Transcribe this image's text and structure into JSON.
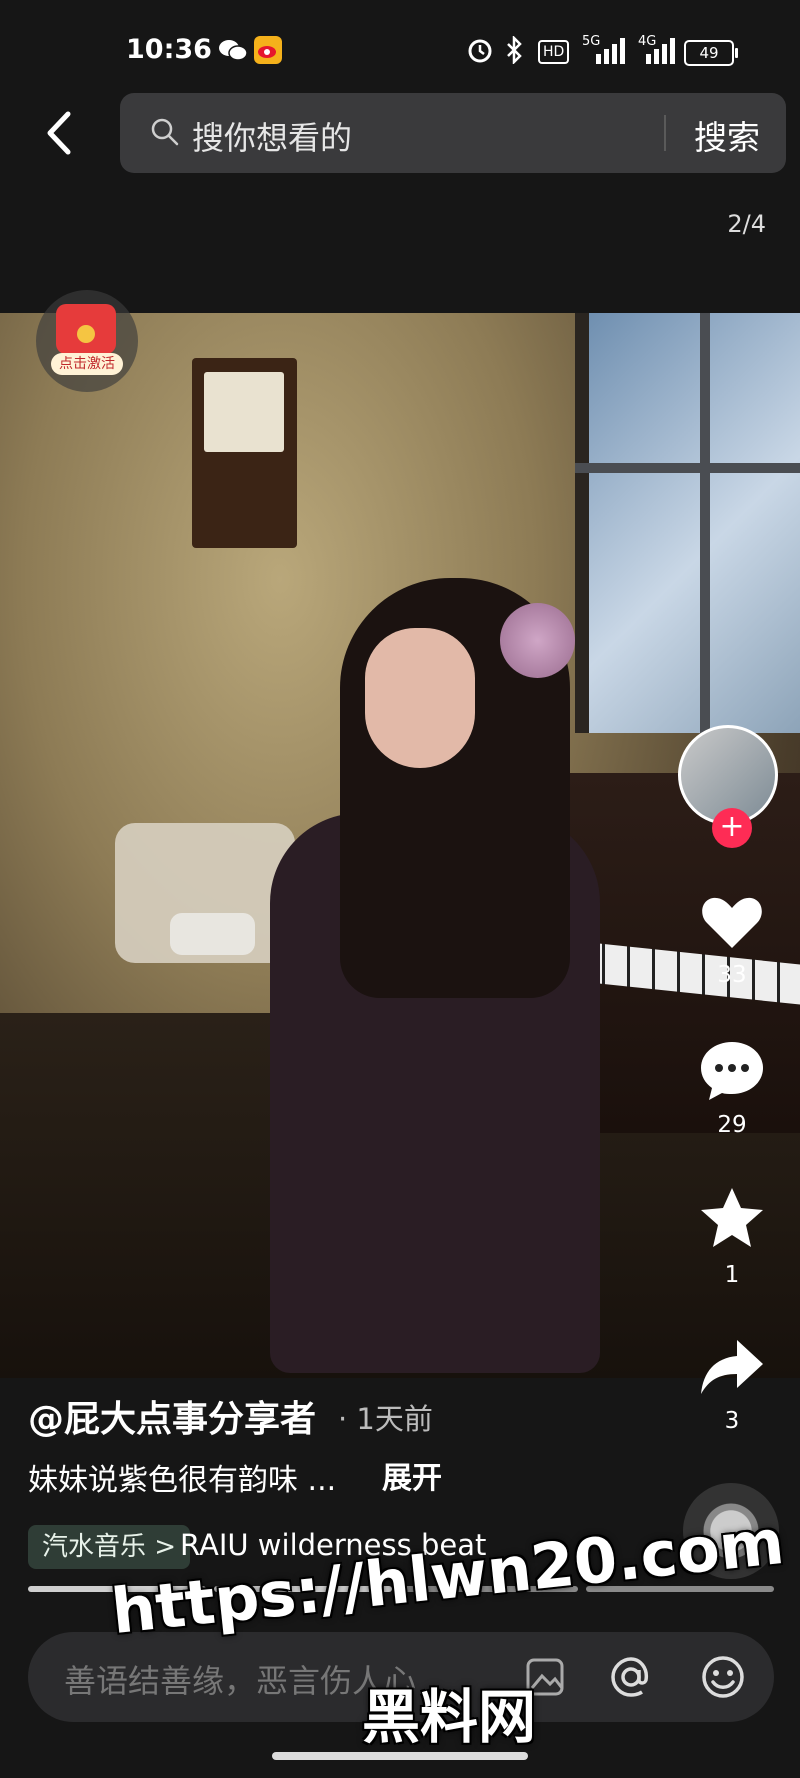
{
  "status_bar": {
    "time": "10:36",
    "signal1": "5G",
    "signal2": "4G",
    "hd": "HD",
    "battery": "49"
  },
  "search": {
    "placeholder": "搜你想看的",
    "button": "搜索"
  },
  "image_counter": "2/4",
  "red_packet_label": "点击激活",
  "actions": {
    "likes": "33",
    "comments": "29",
    "favorites": "1",
    "shares": "3"
  },
  "post": {
    "author": "@屁大点事分享者",
    "time_ago": "· 1天前",
    "description": "妹妹说紫色很有韵味 ...",
    "expand": "展开",
    "music_tag": "汽水音乐 >",
    "music_title": "RAIU    wilderness beat"
  },
  "comment_bar": {
    "placeholder": "善语结善缘，恶言伤人心"
  },
  "watermark": {
    "url": "https://hlwn20.com",
    "name": "黑料网"
  },
  "colors": {
    "accent": "#fe2c55",
    "search_bg": "#3a3a3c"
  }
}
